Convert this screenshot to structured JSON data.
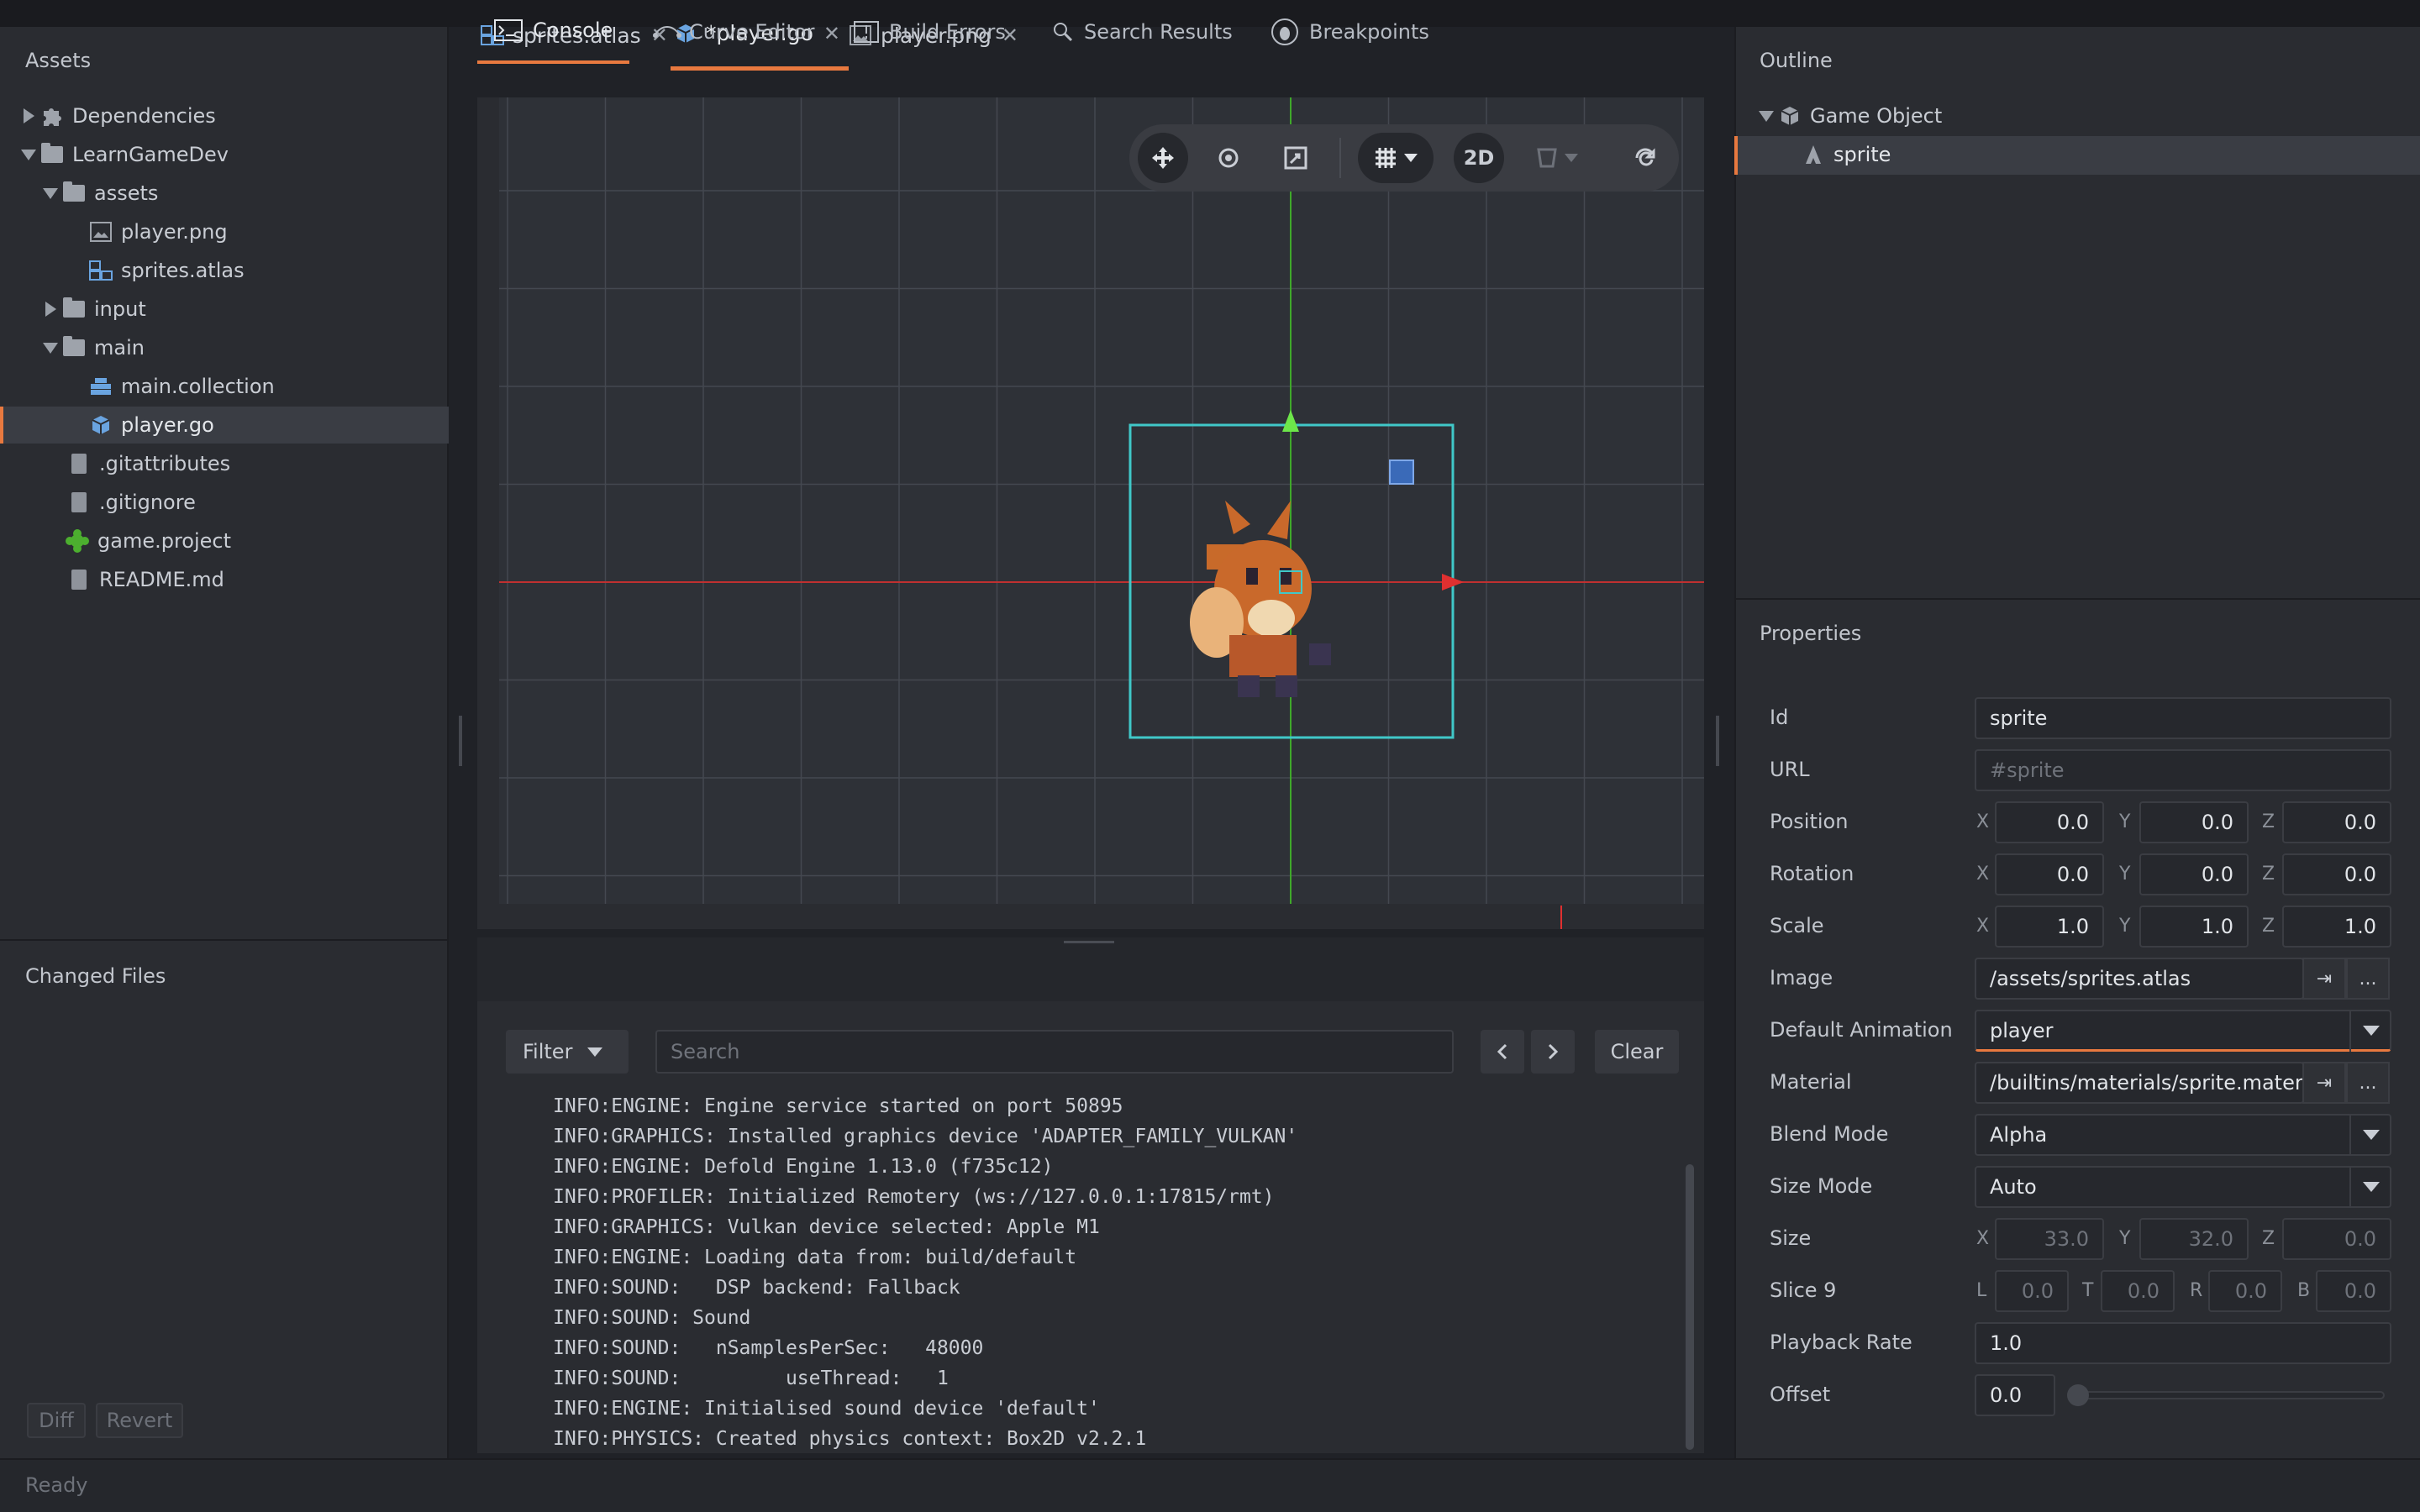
{
  "status": "Ready",
  "assets_panel": {
    "title": "Assets",
    "items": [
      {
        "label": "Dependencies",
        "icon": "puzzle-icon",
        "expanded": false
      },
      {
        "label": "LearnGameDev",
        "icon": "folder-icon",
        "expanded": true
      },
      {
        "label": "assets",
        "icon": "folder-icon",
        "expanded": true
      },
      {
        "label": "player.png",
        "icon": "image-icon"
      },
      {
        "label": "sprites.atlas",
        "icon": "atlas-icon"
      },
      {
        "label": "input",
        "icon": "folder-icon",
        "expanded": false
      },
      {
        "label": "main",
        "icon": "folder-icon",
        "expanded": true
      },
      {
        "label": "main.collection",
        "icon": "collection-icon"
      },
      {
        "label": "player.go",
        "icon": "gameobject-icon",
        "selected": true
      },
      {
        "label": ".gitattributes",
        "icon": "file-icon"
      },
      {
        "label": ".gitignore",
        "icon": "file-icon"
      },
      {
        "label": "game.project",
        "icon": "project-icon"
      },
      {
        "label": "README.md",
        "icon": "file-icon"
      }
    ]
  },
  "changed_files": {
    "title": "Changed Files",
    "diff_label": "Diff",
    "revert_label": "Revert"
  },
  "editor_tabs": [
    {
      "label": "sprites.atlas",
      "icon": "atlas-icon"
    },
    {
      "label": "*player.go",
      "icon": "gameobject-icon",
      "active": true
    },
    {
      "label": "player.png",
      "icon": "image-icon"
    }
  ],
  "viewport": {
    "toolbar": {
      "mode_2d": "2D"
    },
    "x_ticks": [
      "-80",
      "-70",
      "-60",
      "-50",
      "-40",
      "-30",
      "-20",
      "-10",
      "0",
      "10",
      "20",
      "30",
      "40"
    ],
    "y_ticks": [
      "40",
      "30",
      "20",
      "10",
      "0",
      "-10",
      "-20",
      "-30"
    ]
  },
  "bottom_tabs": [
    {
      "label": "Console",
      "icon": "console-icon",
      "active": true
    },
    {
      "label": "Curve Editor",
      "icon": "curve-icon"
    },
    {
      "label": "Build Errors",
      "icon": "error-icon"
    },
    {
      "label": "Search Results",
      "icon": "search-icon"
    },
    {
      "label": "Breakpoints",
      "icon": "bug-icon"
    }
  ],
  "console": {
    "filter_label": "Filter",
    "search_placeholder": "Search",
    "clear_label": "Clear",
    "lines": [
      "INFO:ENGINE: Engine service started on port 50895",
      "INFO:GRAPHICS: Installed graphics device 'ADAPTER_FAMILY_VULKAN'",
      "INFO:ENGINE: Defold Engine 1.13.0 (f735c12)",
      "INFO:PROFILER: Initialized Remotery (ws://127.0.0.1:17815/rmt)",
      "INFO:GRAPHICS: Vulkan device selected: Apple M1",
      "INFO:ENGINE: Loading data from: build/default",
      "INFO:SOUND:   DSP backend: Fallback",
      "INFO:SOUND: Sound",
      "INFO:SOUND:   nSamplesPerSec:   48000",
      "INFO:SOUND:         useThread:   1",
      "INFO:ENGINE: Initialised sound device 'default'",
      "INFO:PHYSICS: Created physics context: Box2D v2.2.1"
    ]
  },
  "outline": {
    "title": "Outline",
    "root": "Game Object",
    "child": "sprite"
  },
  "properties": {
    "title": "Properties",
    "id_label": "Id",
    "id_value": "sprite",
    "url_label": "URL",
    "url_value": "#sprite",
    "position_label": "Position",
    "position": [
      "0.0",
      "0.0",
      "0.0"
    ],
    "rotation_label": "Rotation",
    "rotation": [
      "0.0",
      "0.0",
      "0.0"
    ],
    "scale_label": "Scale",
    "scale": [
      "1.0",
      "1.0",
      "1.0"
    ],
    "image_label": "Image",
    "image_value": "/assets/sprites.atlas",
    "default_animation_label": "Default Animation",
    "default_animation_value": "player",
    "material_label": "Material",
    "material_value": "/builtins/materials/sprite.materi",
    "blend_mode_label": "Blend Mode",
    "blend_mode_value": "Alpha",
    "size_mode_label": "Size Mode",
    "size_mode_value": "Auto",
    "size_label": "Size",
    "size": [
      "33.0",
      "32.0",
      "0.0"
    ],
    "slice9_label": "Slice 9",
    "slice9": [
      "0.0",
      "0.0",
      "0.0",
      "0.0"
    ],
    "playback_rate_label": "Playback Rate",
    "playback_rate_value": "1.0",
    "offset_label": "Offset",
    "offset_value": "0.0",
    "axis_x": "X",
    "axis_y": "Y",
    "axis_z": "Z",
    "axis_l": "L",
    "axis_t": "T",
    "axis_r": "R",
    "axis_b": "B",
    "ellipsis": "..."
  },
  "colors": {
    "accent": "#e8793f",
    "axis_x": "#e03030",
    "axis_y": "#4caf2f",
    "bounds": "#40c8c8"
  }
}
